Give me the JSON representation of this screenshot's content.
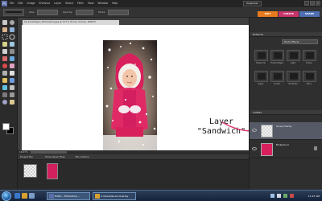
{
  "titlebar": {
    "app_icon": "Ps",
    "menu": [
      "File",
      "Edit",
      "Image",
      "Enhance",
      "Layer",
      "Select",
      "Filter",
      "View",
      "Window",
      "Help"
    ],
    "organizer_label": "Organizer",
    "window_buttons": [
      "_",
      "□",
      "×"
    ]
  },
  "options": {
    "labels": [
      "Size:",
      "Opacity:",
      "Mode:"
    ]
  },
  "mode_tabs": [
    "EDIT",
    "CREATE",
    "SHARE"
  ],
  "document": {
    "tab_title": "04_Snow\\Vegan_Photos\\Girl\\g.jpg @ 16.7% (Snowy Overlay, RGB/8*)",
    "annotation_line1": "Layer",
    "annotation_line2": "\"Sandwich\""
  },
  "status": {
    "zoom": "16.67%"
  },
  "project_bin": {
    "label": "Project Bin",
    "show_label": "Show Open Files",
    "hide_label": "Bin Actions"
  },
  "effects_panel": {
    "title": "EFFECTS",
    "dropdown": "Photo Effects",
    "tiles": [
      "Faded Ink",
      "Frame Edges",
      "Light",
      "Frame",
      "Sepia",
      "Tinted",
      "Old Photo",
      "Mono"
    ]
  },
  "layers_panel": {
    "title": "LAYERS",
    "rows": [
      {
        "name": "Snowy Overlay",
        "selected": true
      },
      {
        "name": "Background",
        "selected": false
      }
    ]
  },
  "taskbar": {
    "tasks": [
      "Editor - Photoshop ...",
      "C:\\Users\\Snow Overlay"
    ],
    "clock": "11:47 AM"
  },
  "colors": {
    "edit_tab": "#e87b1e",
    "create_tab": "#c9356b",
    "share_tab": "#4f6fb2",
    "arrow": "#e0336d",
    "coat_pink": "#d8205c"
  }
}
